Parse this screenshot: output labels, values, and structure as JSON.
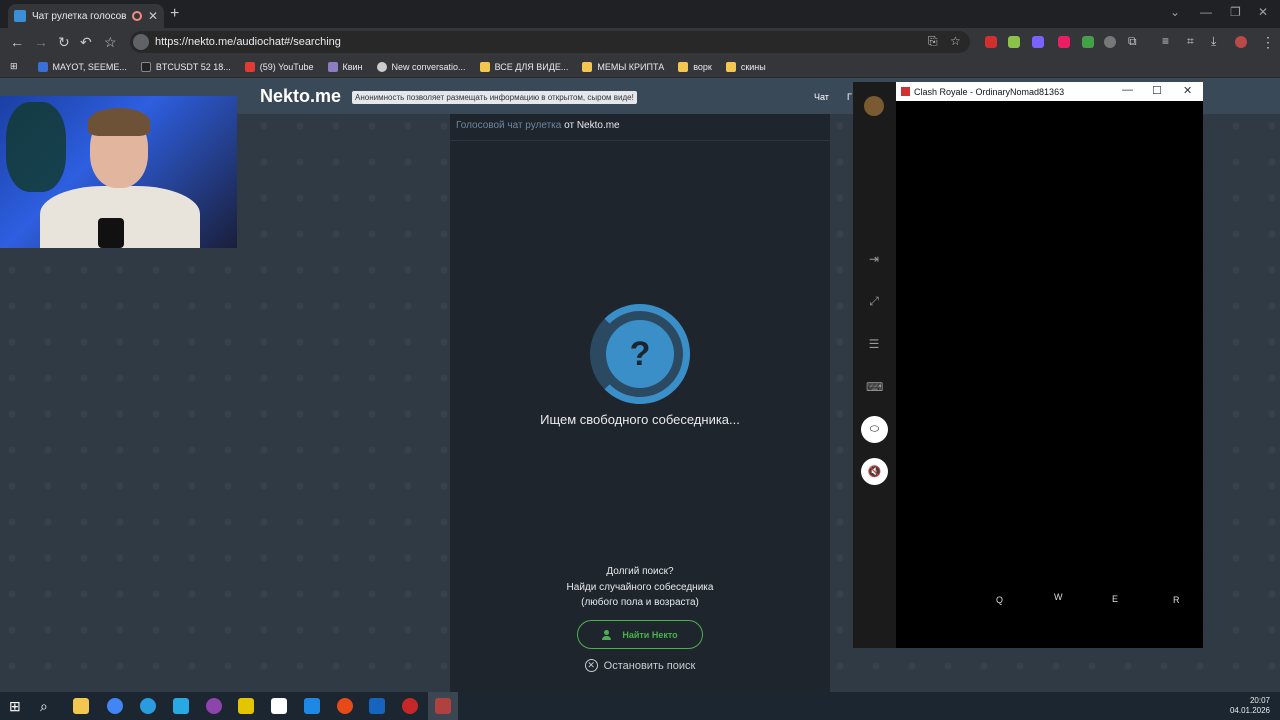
{
  "browser": {
    "tab_title": "Чат рулетка голосовая —",
    "new_tab": "+",
    "url": "https://nekto.me/audiochat#/searching",
    "bookmarks": [
      {
        "label": "MAYOT, SEEME...",
        "color": "#3b6fd8"
      },
      {
        "label": "BTCUSDT 52 18...",
        "color": "#222222"
      },
      {
        "label": "(59) YouTube",
        "color": "#e53935"
      },
      {
        "label": "Квин",
        "color": "#8e7cc3"
      },
      {
        "label": "New conversatio...",
        "color": "#cccccc"
      },
      {
        "label": "ВСЕ ДЛЯ ВИДЕ...",
        "color": "#f3c74f"
      },
      {
        "label": "МЕМЫ КРИПТА",
        "color": "#f3c74f"
      },
      {
        "label": "ворк",
        "color": "#f3c74f"
      },
      {
        "label": "скины",
        "color": "#f3c74f"
      }
    ]
  },
  "site": {
    "logo": "Nekto.me",
    "notice": "Анонимность позволяет размещать информацию в открытом, сыром виде!",
    "nav_chat": "Чат",
    "nav_second": "Г"
  },
  "chat": {
    "header_link": "Голосовой чат рулетка",
    "header_rest": " от Nekto.me",
    "spinner_glyph": "?",
    "searching": "Ищем свободного собеседника...",
    "tip_line1": "Долгий поиск?",
    "tip_line2": "Найди случайного собеседника",
    "tip_line3": "(любого пола и возраста)",
    "find_button": "Найти Некто",
    "stop_button": "Остановить поиск"
  },
  "game": {
    "window_title": "Clash Royale - OrdinaryNomad81363",
    "keys": [
      "Q",
      "W",
      "E",
      "R"
    ]
  },
  "taskbar": {
    "time": "20:07",
    "date": "04.01.2026"
  },
  "colors": {
    "accent_green": "#4caf50",
    "accent_blue": "#3a8fc8"
  }
}
